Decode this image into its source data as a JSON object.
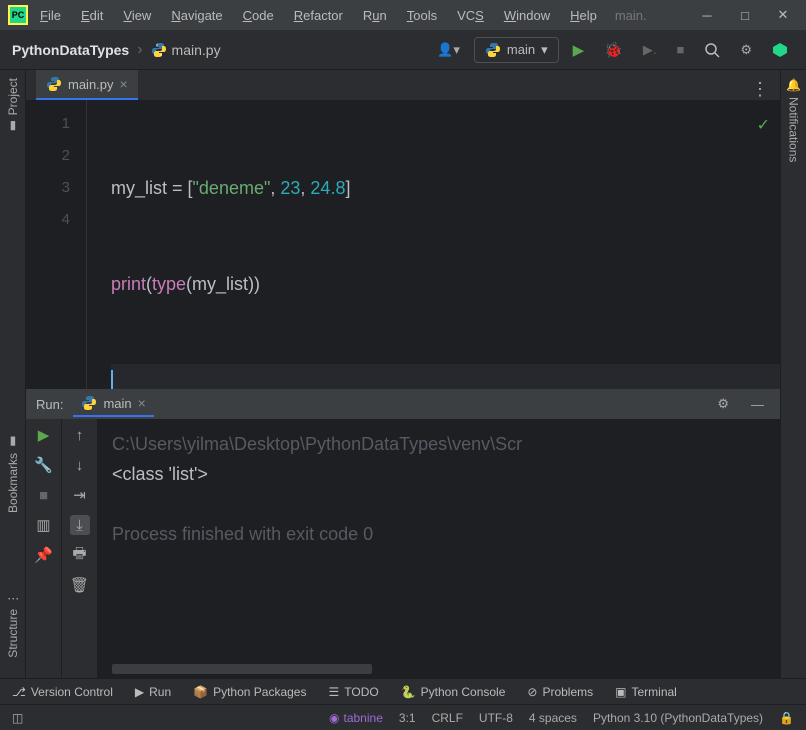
{
  "menu": {
    "file": "File",
    "edit": "Edit",
    "view": "View",
    "navigate": "Navigate",
    "code": "Code",
    "refactor": "Refactor",
    "run": "Run",
    "tools": "Tools",
    "vcs": "VCS",
    "window": "Window",
    "help": "Help"
  },
  "title_suffix": "main.",
  "breadcrumb": {
    "project": "PythonDataTypes",
    "file": "main.py"
  },
  "run_config": {
    "label": "main"
  },
  "tabs": [
    {
      "label": "main.py"
    }
  ],
  "editor": {
    "lines": [
      "1",
      "2",
      "3",
      "4"
    ],
    "code": {
      "l1": {
        "var": "my_list",
        "eq": " = [",
        "s": "\"deneme\"",
        "c1": ", ",
        "n1": "23",
        "c2": ", ",
        "n2": "24.8",
        "end": "]"
      },
      "l2": {
        "fn": "print",
        "p1": "(",
        "bi": "type",
        "p2": "(",
        "var": "my_list",
        "p3": "))"
      }
    }
  },
  "left_rail": {
    "project": "Project",
    "bookmarks": "Bookmarks",
    "structure": "Structure"
  },
  "right_rail": {
    "notifications": "Notifications"
  },
  "run_panel": {
    "title": "Run:",
    "tab": "main",
    "out_path": "C:\\Users\\yilma\\Desktop\\PythonDataTypes\\venv\\Scr",
    "out_result": "<class 'list'>",
    "out_exit": "Process finished with exit code 0"
  },
  "bottom": {
    "vcs": "Version Control",
    "run": "Run",
    "pkg": "Python Packages",
    "todo": "TODO",
    "console": "Python Console",
    "problems": "Problems",
    "terminal": "Terminal"
  },
  "status": {
    "tabnine": "tabnine",
    "pos": "3:1",
    "le": "CRLF",
    "enc": "UTF-8",
    "indent": "4 spaces",
    "interp": "Python 3.10 (PythonDataTypes)"
  }
}
